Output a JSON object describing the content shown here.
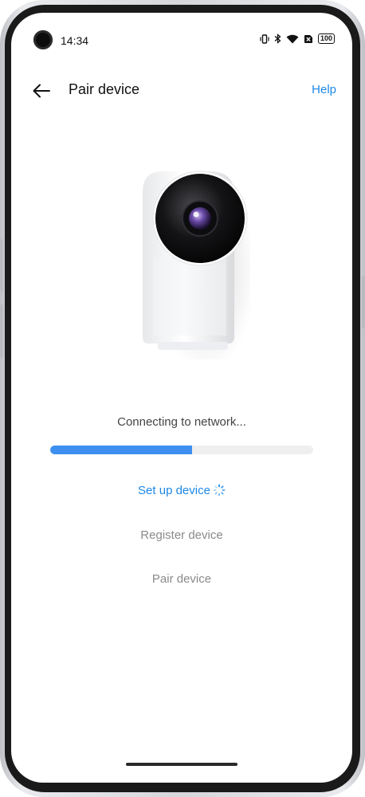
{
  "status_bar": {
    "time": "14:34",
    "battery": "100",
    "icons": [
      "vibrate-icon",
      "bluetooth-icon",
      "wifi-icon",
      "sim-off-icon",
      "battery-icon"
    ]
  },
  "app_bar": {
    "title": "Pair device",
    "help_label": "Help",
    "back_icon": "arrow-left-icon"
  },
  "progress": {
    "status_text": "Connecting to network...",
    "value": 0.54,
    "color": "#3d8ff0",
    "track_color": "#efefef"
  },
  "steps": [
    {
      "label": "Set up device",
      "state": "active"
    },
    {
      "label": "Register device",
      "state": "pending"
    },
    {
      "label": "Pair device",
      "state": "pending"
    }
  ],
  "colors": {
    "accent": "#1e88e5",
    "pending_text": "#8a8a8a"
  }
}
